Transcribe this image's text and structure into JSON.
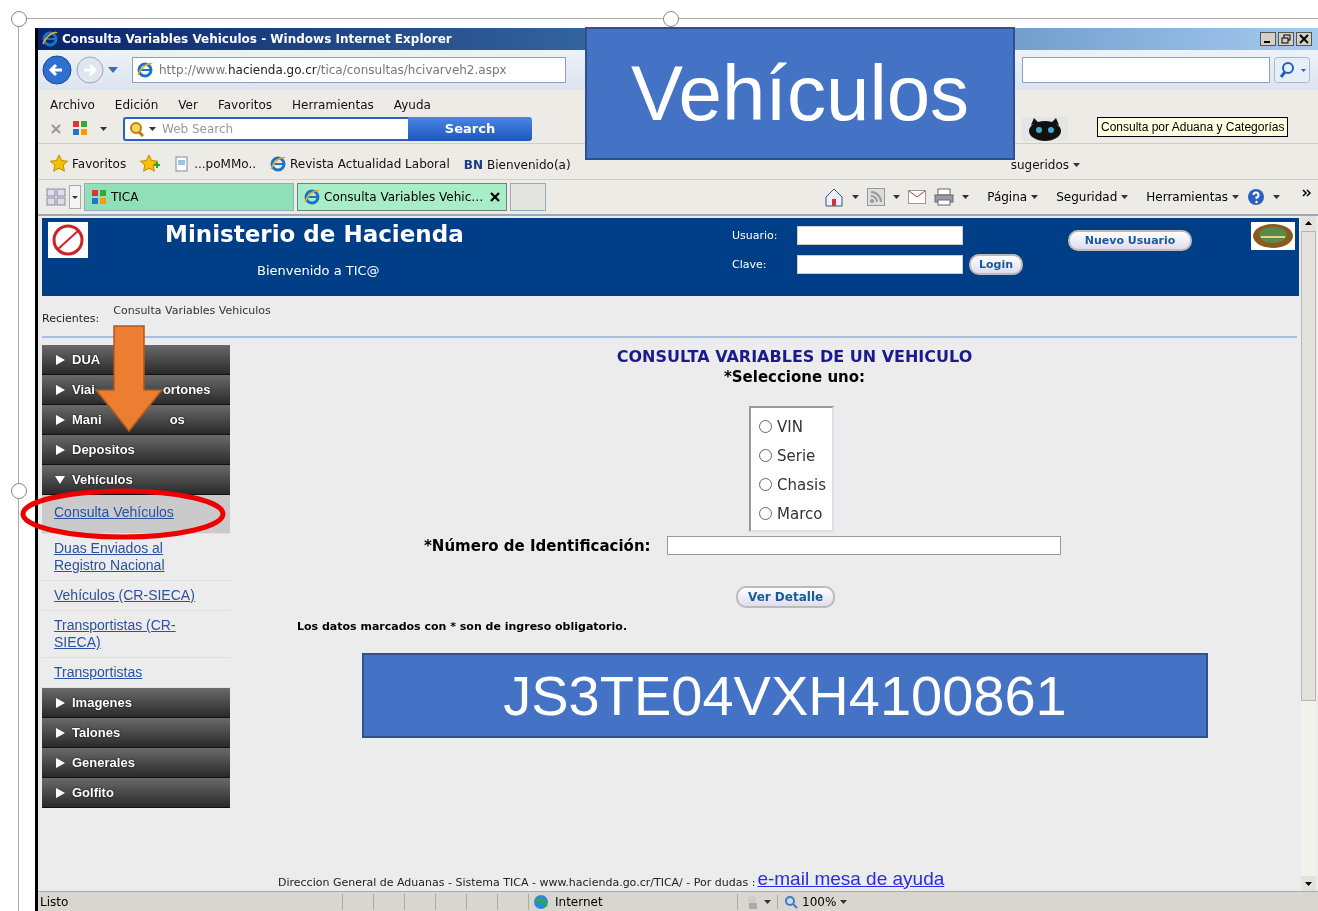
{
  "window": {
    "title": "Consulta Variables Vehiculos - Windows Internet Explorer"
  },
  "address_bar": {
    "url": "http://www.**hacienda.go.cr**/tica/consultas/hcivarveh2.aspx"
  },
  "menu": [
    "Archivo",
    "Edición",
    "Ver",
    "Favoritos",
    "Herramientas",
    "Ayuda"
  ],
  "search": {
    "placeholder": "Web Search",
    "button": "Search"
  },
  "tooltip": "Consulta por Aduana y Categorías",
  "favorites_bar": {
    "label": "Favoritos",
    "links": [
      {
        "text": "...poMMo.."
      },
      {
        "text": "Revista Actualidad Laboral"
      },
      {
        "text": "Bienvenido(a)",
        "badge": "BN"
      },
      {
        "text": "sugeridos"
      }
    ]
  },
  "tabs": [
    {
      "label": "TICA",
      "selected": false
    },
    {
      "label": "Consulta Variables Vehic…",
      "selected": true
    }
  ],
  "command_bar": [
    "Página",
    "Seguridad",
    "Herramientas"
  ],
  "header": {
    "title": "Ministerio de Hacienda",
    "welcome": "Bienvenido a TIC@",
    "user_label": "Usuario:",
    "password_label": "Clave:",
    "login": "Login",
    "new_user": "Nuevo Usuario"
  },
  "recent": {
    "label": "Recientes:",
    "item": "Consulta Variables Vehiculos"
  },
  "sidebar": {
    "items": [
      {
        "label": "DUA",
        "expanded": false
      },
      {
        "label": "Viai",
        "label_end": "ortones",
        "expanded": false
      },
      {
        "label": "Mani",
        "label_end": "os",
        "expanded": false
      },
      {
        "label": "Depositos",
        "expanded": false
      },
      {
        "label": "Vehículos",
        "expanded": true,
        "children": [
          {
            "label": "Consulta Vehículos",
            "selected": true
          },
          {
            "label": "Duas Enviados al Registro Nacional",
            "selected": false
          },
          {
            "label": "Vehículos (CR-SIECA)",
            "selected": false
          },
          {
            "label": "Transportistas (CR-SIECA)",
            "selected": false
          },
          {
            "label": "Transportistas",
            "selected": false
          }
        ]
      },
      {
        "label": "Imagenes",
        "expanded": false
      },
      {
        "label": "Talones",
        "expanded": false
      },
      {
        "label": "Generales",
        "expanded": false
      },
      {
        "label": "Golfito",
        "expanded": false
      }
    ]
  },
  "form": {
    "title": "CONSULTA VARIABLES DE UN VEHICULO",
    "prompt": "*Seleccione uno:",
    "options": [
      {
        "label": "VIN",
        "selected": false
      },
      {
        "label": "Serie",
        "selected": false
      },
      {
        "label": "Chasis",
        "selected": false
      },
      {
        "label": "Marco",
        "selected": false
      }
    ],
    "id_label": "*Número de Identificación:",
    "button": "Ver Detalle",
    "note": "Los datos marcados con * son de ingreso obligatorio."
  },
  "footer": {
    "text": "Direccion General de Aduanas - Sistema TICA - www.hacienda.go.cr/TICA/ - Por dudas :",
    "link": "e-mail mesa de ayuda"
  },
  "status_bar": {
    "text": "Listo",
    "zone": "Internet",
    "zoom": "100%"
  },
  "annotations": {
    "callout": "Vehículos",
    "vin": "JS3TE04VXH4100861"
  }
}
